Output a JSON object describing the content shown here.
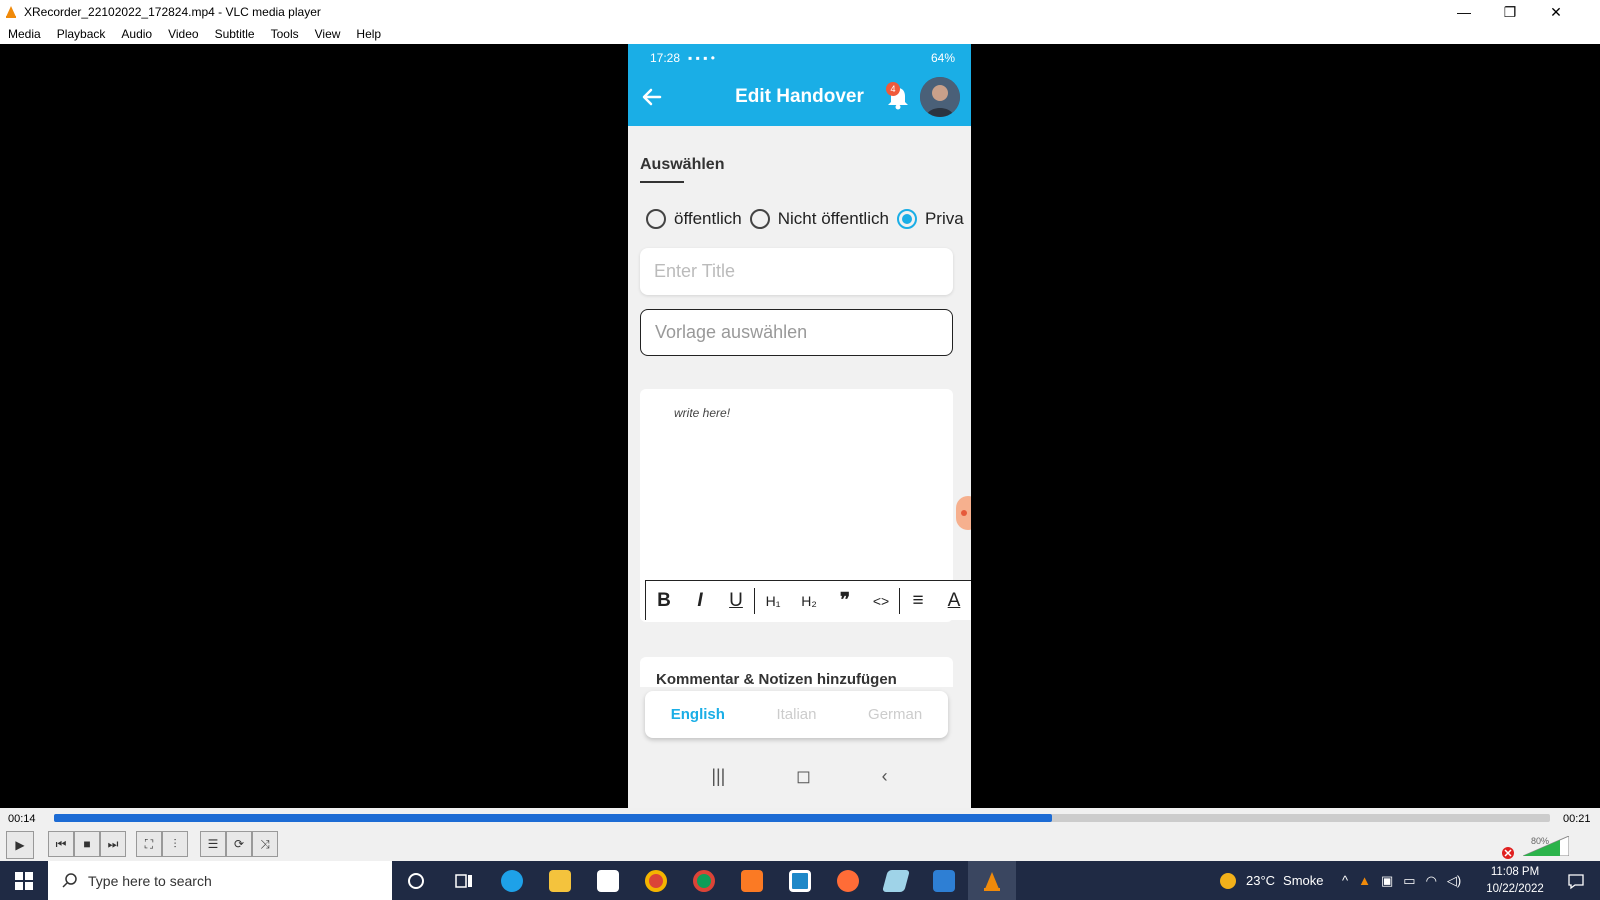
{
  "window": {
    "title": "XRecorder_22102022_172824.mp4 - VLC media player"
  },
  "menu": [
    "Media",
    "Playback",
    "Audio",
    "Video",
    "Subtitle",
    "Tools",
    "View",
    "Help"
  ],
  "phone": {
    "status": {
      "time": "17:28",
      "battery": "64%"
    },
    "appbar": {
      "title": "Edit Handover",
      "notification_count": "4"
    },
    "section_title": "Auswählen",
    "radios": [
      {
        "label": "öffentlich",
        "checked": false
      },
      {
        "label": "Nicht öffentlich",
        "checked": false
      },
      {
        "label": "Priva",
        "checked": true
      }
    ],
    "title_field": {
      "placeholder": "Enter Title"
    },
    "template_field": {
      "placeholder": "Vorlage auswählen"
    },
    "editor": {
      "placeholder": "write here!",
      "toolbar": {
        "bold": "B",
        "italic": "I",
        "underline": "U",
        "h1": "H₁",
        "h2": "H₂",
        "quote": "❞",
        "code": "<>",
        "align": "≡",
        "color": "A"
      }
    },
    "second_card_peek": "Kommentar & Notizen hinzufügen",
    "languages": [
      {
        "label": "English",
        "active": true
      },
      {
        "label": "Italian",
        "active": false
      },
      {
        "label": "German",
        "active": false
      }
    ],
    "nav": {
      "recents": "|||",
      "home": "◻",
      "back": "‹"
    }
  },
  "player": {
    "elapsed": "00:14",
    "total": "00:21",
    "progress": 0.667,
    "volume": "80%"
  },
  "taskbar": {
    "search_placeholder": "Type here to search",
    "weather": {
      "temp": "23°C",
      "condition": "Smoke"
    },
    "clock": {
      "time": "11:08 PM",
      "date": "10/22/2022"
    }
  },
  "colors": {
    "accent": "#1aaee6",
    "seek": "#1c6bd4",
    "taskbar": "#1f2a44"
  }
}
